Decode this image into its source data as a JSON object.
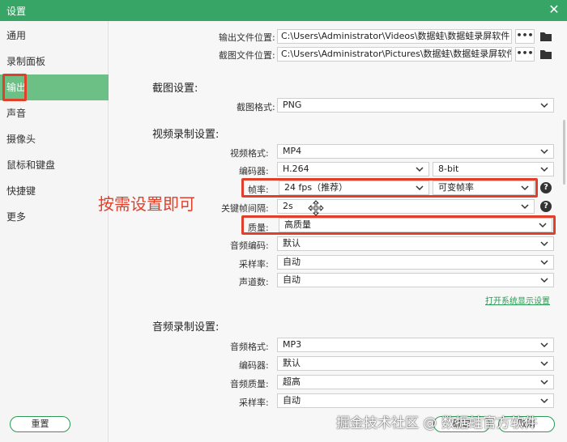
{
  "window": {
    "title": "设置",
    "close_glyph": "✕"
  },
  "sidebar": {
    "items": [
      {
        "label": "通用"
      },
      {
        "label": "录制面板"
      },
      {
        "label": "输出"
      },
      {
        "label": "声音"
      },
      {
        "label": "摄像头"
      },
      {
        "label": "鼠标和键盘"
      },
      {
        "label": "快捷键"
      },
      {
        "label": "更多"
      }
    ],
    "active_index": 2
  },
  "output_paths": {
    "output_folder_label": "输出文件位置:",
    "output_folder_value": "C:\\Users\\Administrator\\Videos\\数据蛙\\数据蛙录屏软件",
    "screenshot_folder_label": "截图文件位置:",
    "screenshot_folder_value": "C:\\Users\\Administrator\\Pictures\\数据蛙\\数据蛙录屏软件",
    "browse_label": "•••"
  },
  "screenshot_settings": {
    "title": "截图设置:",
    "format_label": "截图格式:",
    "format_value": "PNG"
  },
  "video_settings": {
    "title": "视频录制设置:",
    "format_label": "视频格式:",
    "format_value": "MP4",
    "encoder_label": "编码器:",
    "encoder_value": "H.264",
    "bitdepth_value": "8-bit",
    "framerate_label": "帧率:",
    "framerate_value": "24 fps（推荐）",
    "framerate_mode_value": "可变帧率",
    "keyframe_label": "关键帧间隔:",
    "keyframe_value": "2s",
    "quality_label": "质量:",
    "quality_value": "高质量",
    "audio_codec_label": "音频编码:",
    "audio_codec_value": "默认",
    "sample_rate_label": "采样率:",
    "sample_rate_value": "自动",
    "channels_label": "声道数:",
    "channels_value": "自动",
    "system_display_link": "打开系统显示设置"
  },
  "audio_settings": {
    "title": "音频录制设置:",
    "format_label": "音频格式:",
    "format_value": "MP3",
    "encoder_label": "编码器:",
    "encoder_value": "默认",
    "quality_label": "音频质量:",
    "quality_value": "超高",
    "sample_rate_label": "采样率:",
    "sample_rate_value": "自动"
  },
  "annotation": {
    "text": "按需设置即可"
  },
  "footer": {
    "reset_label": "重置",
    "ok_label": "确定",
    "cancel_label": "取消"
  },
  "watermark": {
    "text": "掘金技术社区 @ 数据蛙官方软件"
  },
  "colors": {
    "accent": "#36a566",
    "highlight": "#e0402a",
    "active_item": "#6cbf85"
  }
}
